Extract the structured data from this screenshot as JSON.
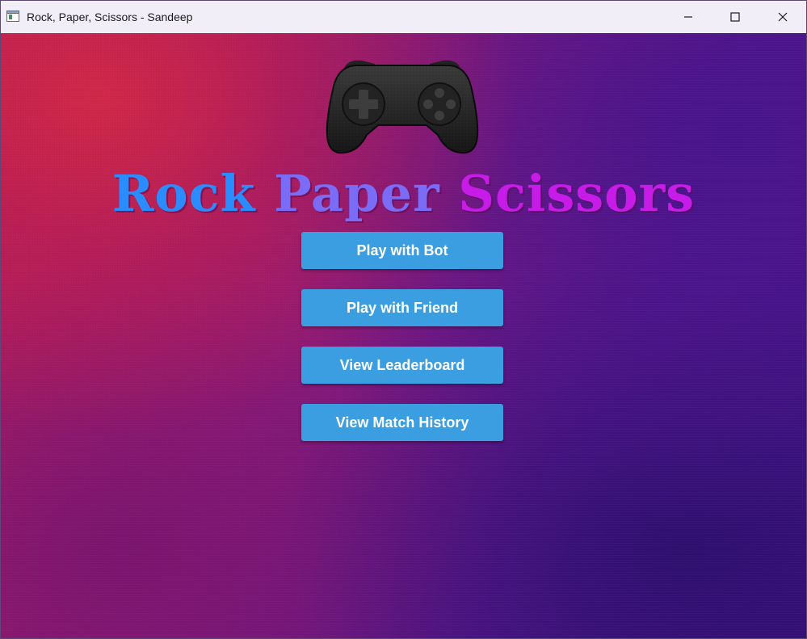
{
  "window": {
    "title": "Rock, Paper, Scissors - Sandeep",
    "app_icon": "window-app-icon",
    "controls": {
      "minimize_icon": "minimize-icon",
      "maximize_icon": "maximize-icon",
      "close_icon": "close-icon"
    }
  },
  "hero": {
    "icon": "gamepad-icon",
    "title_words": [
      "Rock",
      "Paper",
      "Scissors"
    ],
    "title_colors": [
      "#2a8cff",
      "#7a6cf6",
      "#c71ce8"
    ]
  },
  "menu": {
    "buttons": [
      {
        "label": "Play with Bot"
      },
      {
        "label": "Play with Friend"
      },
      {
        "label": "View Leaderboard"
      },
      {
        "label": "View Match History"
      }
    ],
    "button_color": "#3a9ee0"
  },
  "colors": {
    "titlebar": "#f2eef8",
    "background_top_left": "#c01e50",
    "background_bottom_right": "#3a1282"
  }
}
